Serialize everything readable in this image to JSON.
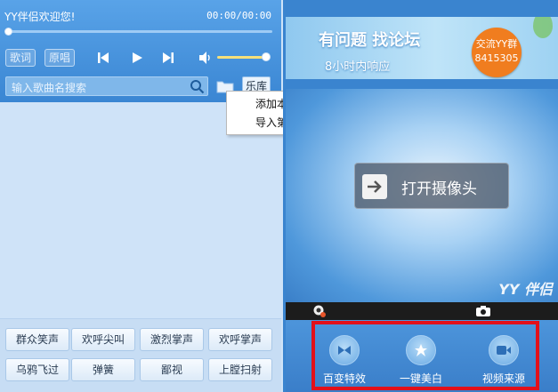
{
  "player": {
    "song_title": "YY伴侣欢迎您!",
    "time": "00:00/00:00",
    "lyrics_btn": "歌词",
    "original_btn": "原唱",
    "progress": 0,
    "volume": 0.9
  },
  "search": {
    "placeholder": "输入歌曲名搜索",
    "library_btn": "乐库"
  },
  "context_menu": {
    "items": [
      "添加本地歌曲",
      "导入第三方播放列表"
    ]
  },
  "sound_effects": {
    "buttons": [
      "群众笑声",
      "欢呼尖叫",
      "激烈掌声",
      "欢呼掌声",
      "乌鸦飞过",
      "弹簧",
      "鄙视",
      "上膛扫射"
    ]
  },
  "banner": {
    "line1": "有问题 找论坛",
    "line2": "8小时内响应",
    "badge_line1": "交流YY群",
    "badge_line2": "8415305"
  },
  "video": {
    "open_camera": "打开摄像头",
    "watermark": "YY 伴侣"
  },
  "effects": {
    "items": [
      {
        "label": "百变特效",
        "icon": "effects-icon"
      },
      {
        "label": "一键美白",
        "icon": "beauty-icon"
      },
      {
        "label": "视频来源",
        "icon": "video-source-icon"
      }
    ]
  },
  "colors": {
    "accent": "#3a84cf",
    "highlight": "#e2101a",
    "badge": "#f07d1f"
  }
}
